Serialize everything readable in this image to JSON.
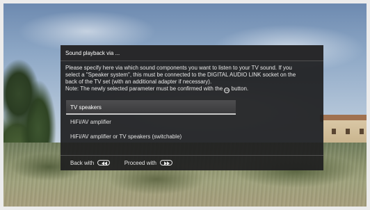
{
  "dialog": {
    "title": "Sound playback via ...",
    "description_line1": "Please specify here via which sound components you want to listen to your TV sound. If you",
    "description_line2": "select a \"Speaker system\", this must be connected to the DIGITAL AUDIO LINK socket on the",
    "description_line3": "back of the TV set (with an additional adapter if necessary).",
    "note_prefix": "Note: The newly selected parameter must be confirmed with the",
    "note_suffix": "button.",
    "ok_icon_text": "OK",
    "options": [
      {
        "label": "TV speakers",
        "selected": true
      },
      {
        "label": "HiFi/AV amplifier",
        "selected": false
      },
      {
        "label": "HiFi/AV amplifier or TV speakers (switchable)",
        "selected": false
      }
    ],
    "footer": {
      "back_label": "Back with",
      "back_icon": "rewind-button-icon",
      "proceed_label": "Proceed with",
      "proceed_icon": "fast-forward-button-icon"
    }
  },
  "colors": {
    "dialog_bg": "#1e1e20",
    "selection_underline": "#c9c9c9",
    "text": "#e6e6e6"
  }
}
